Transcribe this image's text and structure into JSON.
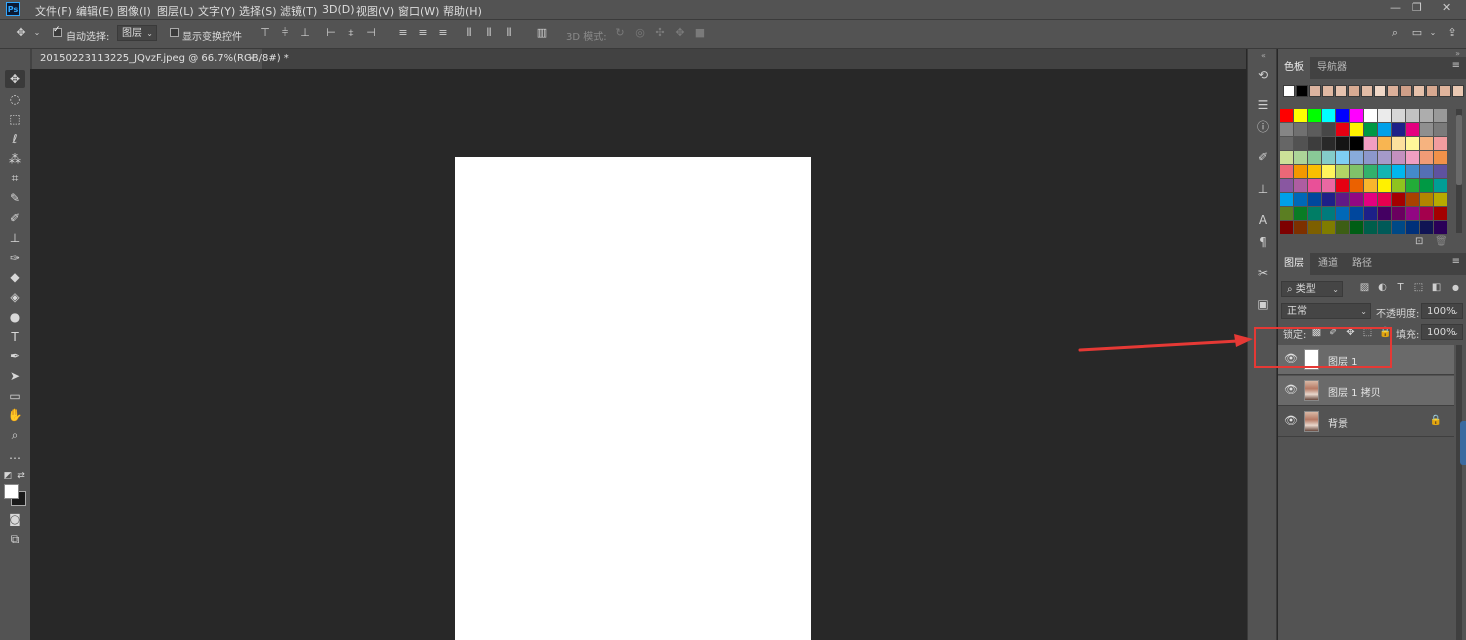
{
  "menubar": {
    "logo": "Ps",
    "items": [
      "文件(F)",
      "编辑(E)",
      "图像(I)",
      "图层(L)",
      "文字(Y)",
      "选择(S)",
      "滤镜(T)",
      "3D(D)",
      "视图(V)",
      "窗口(W)",
      "帮助(H)"
    ],
    "window_controls": {
      "minimize": "—",
      "restore": "❐",
      "close": "✕"
    }
  },
  "options": {
    "auto_select_label": "自动选择:",
    "auto_select_checked": true,
    "auto_select_target": "图层",
    "show_transform_label": "显示变换控件",
    "show_transform_checked": false,
    "mode_3d_label": "3D 模式:"
  },
  "document": {
    "tab_title": "20150223113225_JQvzF.jpeg @ 66.7%(RGB/8#) *",
    "close": "×"
  },
  "swatches_panel": {
    "tabs": [
      "色板",
      "导航器"
    ],
    "active_tab": "色板",
    "recent": [
      "#ffffff",
      "#000000",
      "#dcb4a0",
      "#e0b9a3",
      "#e5c2ae",
      "#d8ab93",
      "#e2bca6",
      "#f0d8c8",
      "#dcb09a",
      "#cf9f88",
      "#e6c1ab",
      "#d7a890",
      "#dfb49c",
      "#e9c8b2"
    ],
    "rows": [
      [
        "#ff0000",
        "#ffff00",
        "#00ff00",
        "#00ffff",
        "#0000ff",
        "#ff00ff",
        "#ffffff",
        "#ebebeb",
        "#d6d6d6",
        "#c2c2c2",
        "#adadad",
        "#999999"
      ],
      [
        "#858585",
        "#707070",
        "#5c5c5c",
        "#474747",
        "#e60012",
        "#fff100",
        "#009944",
        "#00a0e9",
        "#1d2088",
        "#e4007f",
        "#8f8f8f",
        "#7a7a7a"
      ],
      [
        "#666666",
        "#525252",
        "#3d3d3d",
        "#292929",
        "#141414",
        "#000000",
        "#f19ec2",
        "#f8b551",
        "#fce09d",
        "#fff799",
        "#f6b37f",
        "#f29c9f"
      ],
      [
        "#cce198",
        "#acd598",
        "#89c997",
        "#84ccc9",
        "#7ecef4",
        "#88abda",
        "#8c97cb",
        "#a59aca",
        "#c490bf",
        "#f19ec2",
        "#f29b76",
        "#f19149"
      ],
      [
        "#eb6877",
        "#f39800",
        "#fabe00",
        "#fff45c",
        "#b3d465",
        "#80c269",
        "#32b16c",
        "#13b5b1",
        "#00b7ee",
        "#448aca",
        "#556fb5",
        "#5f52a0"
      ],
      [
        "#8957a1",
        "#ae5da1",
        "#e95098",
        "#ea68a2",
        "#e60012",
        "#eb6100",
        "#f8b62d",
        "#fff100",
        "#8fc31f",
        "#22ac38",
        "#009944",
        "#009e96"
      ],
      [
        "#00a0e9",
        "#0068b7",
        "#00479d",
        "#1d2088",
        "#601986",
        "#920783",
        "#e4007f",
        "#e5004f",
        "#a40000",
        "#a84200",
        "#b28500",
        "#b7aa00"
      ],
      [
        "#5b7e22",
        "#097c25",
        "#007d65",
        "#007b7c",
        "#0068b7",
        "#00479d",
        "#1d2088",
        "#440062",
        "#6a005f",
        "#920783",
        "#a4004d",
        "#a40000"
      ],
      [
        "#7d0000",
        "#7d3000",
        "#7d5f00",
        "#7f7c00",
        "#3d5e15",
        "#005e15",
        "#005e4b",
        "#005a58",
        "#004986",
        "#00307a",
        "#101454",
        "#2a0058"
      ]
    ]
  },
  "layers_panel": {
    "tabs": [
      "图层",
      "通道",
      "路径"
    ],
    "active_tab": "图层",
    "filter_label": "类型",
    "blend_mode": "正常",
    "opacity_label": "不透明度:",
    "opacity_value": "100%",
    "lock_label": "锁定:",
    "fill_label": "填充:",
    "fill_value": "100%",
    "layers": [
      {
        "name": "图层 1",
        "thumb": "white",
        "selected": true,
        "locked": false
      },
      {
        "name": "图层 1 拷贝",
        "thumb": "photo",
        "selected": true,
        "locked": false
      },
      {
        "name": "背景",
        "thumb": "photo",
        "selected": false,
        "locked": true
      }
    ]
  },
  "colors": {
    "ui_bg": "#535353",
    "canvas_bg": "#282828",
    "annotation": "#e53935"
  }
}
